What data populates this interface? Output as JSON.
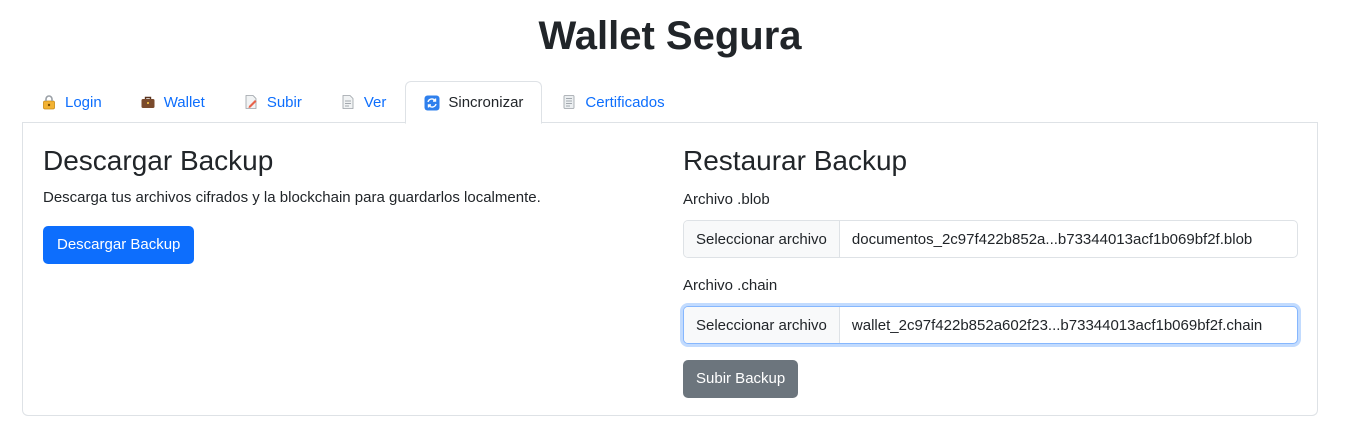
{
  "page": {
    "title": "Wallet Segura"
  },
  "tabs": [
    {
      "label": "Login",
      "icon": "lock-icon",
      "active": false
    },
    {
      "label": "Wallet",
      "icon": "briefcase-icon",
      "active": false
    },
    {
      "label": "Subir",
      "icon": "upload-document-icon",
      "active": false
    },
    {
      "label": "Ver",
      "icon": "document-icon",
      "active": false
    },
    {
      "label": "Sincronizar",
      "icon": "sync-icon",
      "active": true
    },
    {
      "label": "Certificados",
      "icon": "certificate-icon",
      "active": false
    }
  ],
  "download": {
    "heading": "Descargar Backup",
    "description": "Descarga tus archivos cifrados y la blockchain para guardarlos localmente.",
    "button_label": "Descargar Backup"
  },
  "restore": {
    "heading": "Restaurar Backup",
    "blob": {
      "label": "Archivo .blob",
      "button_label": "Seleccionar archivo",
      "file_name": "documentos_2c97f422b852a...b73344013acf1b069bf2f.blob"
    },
    "chain": {
      "label": "Archivo .chain",
      "button_label": "Seleccionar archivo",
      "file_name": "wallet_2c97f422b852a602f23...b73344013acf1b069bf2f.chain"
    },
    "submit_label": "Subir Backup"
  },
  "colors": {
    "primary": "#0d6efd",
    "secondary": "#6c757d",
    "text": "#212529",
    "border": "#dee2e6"
  }
}
